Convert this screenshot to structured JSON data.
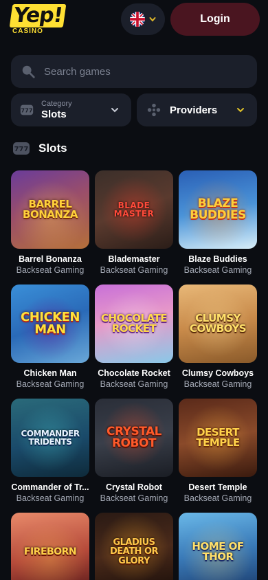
{
  "header": {
    "logo_text": "Yep!",
    "logo_sub": "CASINO",
    "language_flag": "uk-flag-icon",
    "login_label": "Login"
  },
  "search": {
    "placeholder": "Search games"
  },
  "filters": {
    "category_label": "Category",
    "category_value": "Slots",
    "providers_label": "Providers"
  },
  "section": {
    "title": "Slots"
  },
  "colors": {
    "accent_yellow": "#ffe033",
    "login_bg": "#4a1520",
    "panel_bg": "#1b1f2a",
    "page_bg": "#0b0d12"
  },
  "games": [
    {
      "name": "Barrel Bonanza",
      "provider": "Backseat Gaming",
      "art": "BARREL BONANZA"
    },
    {
      "name": "Blademaster",
      "provider": "Backseat Gaming",
      "art": "BLADE MASTER"
    },
    {
      "name": "Blaze Buddies",
      "provider": "Backseat Gaming",
      "art": "BLAZE BUDDIES"
    },
    {
      "name": "Chicken Man",
      "provider": "Backseat Gaming",
      "art": "CHICKEN MAN"
    },
    {
      "name": "Chocolate Rocket",
      "provider": "Backseat Gaming",
      "art": "CHOCOLATE ROCKET"
    },
    {
      "name": "Clumsy Cowboys",
      "provider": "Backseat Gaming",
      "art": "CLUMSY COWBOYS"
    },
    {
      "name": "Commander of Tr...",
      "provider": "Backseat Gaming",
      "art": "COMMANDER TRIDENTS"
    },
    {
      "name": "Crystal Robot",
      "provider": "Backseat Gaming",
      "art": "CRYSTAL ROBOT"
    },
    {
      "name": "Desert Temple",
      "provider": "Backseat Gaming",
      "art": "DESERT TEMPLE"
    },
    {
      "name": "",
      "provider": "",
      "art": "FIREBORN"
    },
    {
      "name": "",
      "provider": "",
      "art": "GLADIUS DEATH OR GLORY"
    },
    {
      "name": "",
      "provider": "",
      "art": "HOME OF THOR"
    }
  ]
}
